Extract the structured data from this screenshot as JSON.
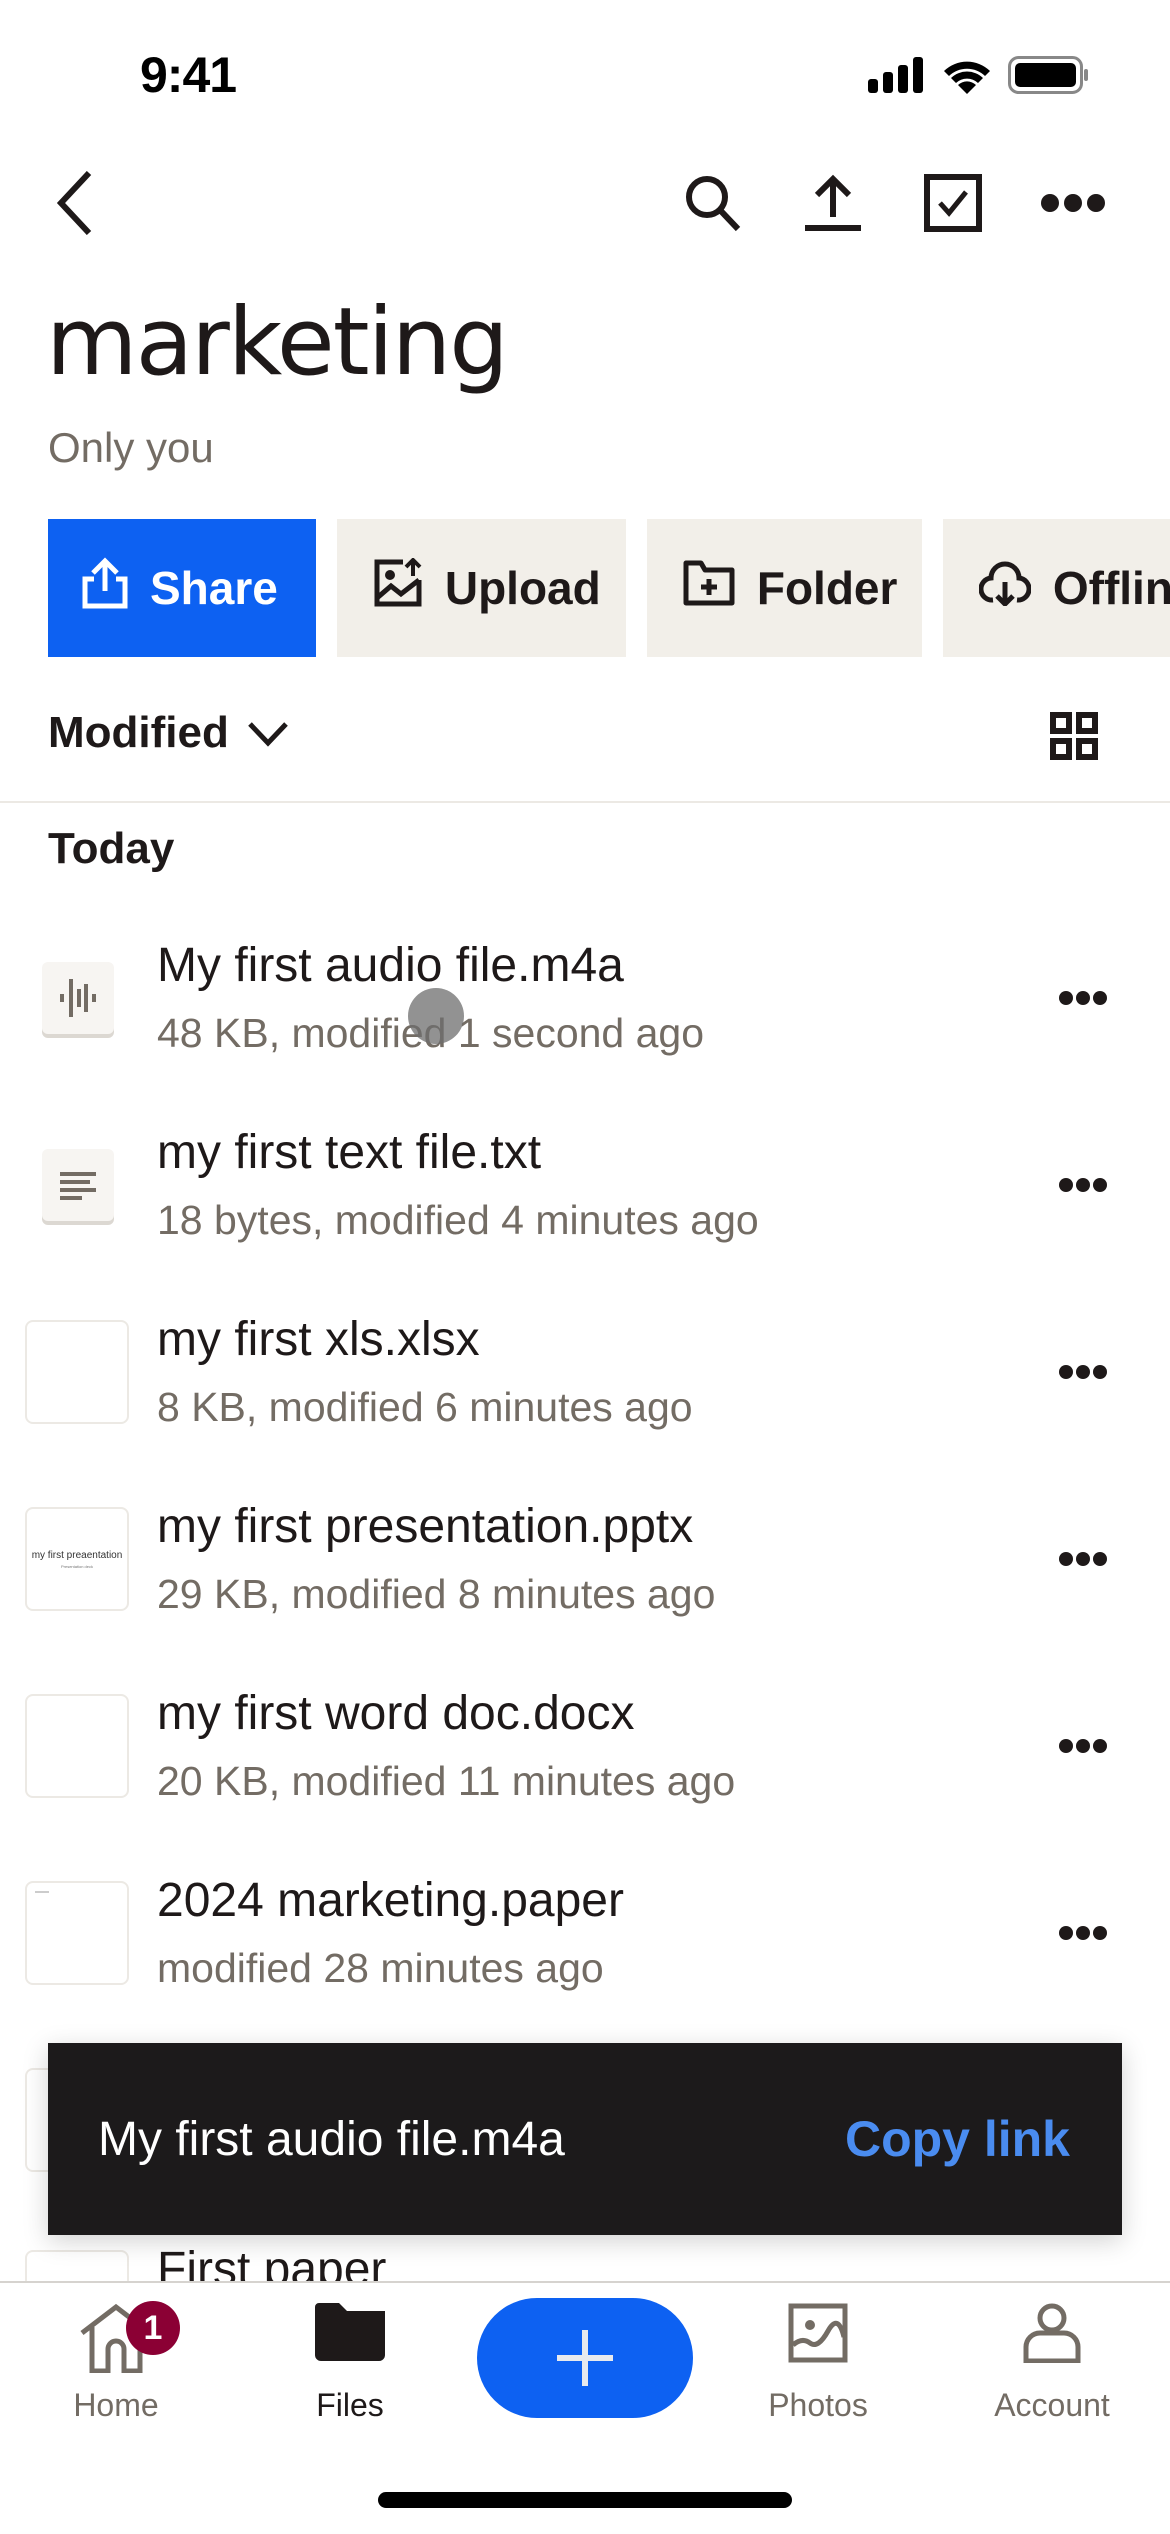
{
  "status_bar": {
    "time": "9:41",
    "icons": [
      "cellular-signal-icon",
      "wifi-icon",
      "battery-icon"
    ]
  },
  "nav": {
    "back_icon": "chevron-left-icon",
    "actions": [
      {
        "name": "search",
        "icon": "search-icon"
      },
      {
        "name": "upload",
        "icon": "upload-icon"
      },
      {
        "name": "select",
        "icon": "checkbox-icon"
      },
      {
        "name": "more",
        "icon": "more-horizontal-icon"
      }
    ]
  },
  "folder": {
    "title": "marketing",
    "sharing": "Only you"
  },
  "actions": [
    {
      "label": "Share",
      "icon": "share-icon",
      "primary": true
    },
    {
      "label": "Upload",
      "icon": "upload-photo-icon",
      "primary": false
    },
    {
      "label": "Folder",
      "icon": "new-folder-icon",
      "primary": false
    },
    {
      "label": "Offline",
      "icon": "cloud-download-icon",
      "primary": false
    }
  ],
  "sort": {
    "label": "Modified",
    "view_toggle_icon": "grid-view-icon"
  },
  "sections": [
    {
      "label": "Today",
      "files": [
        {
          "name": "My first audio file.m4a",
          "meta": "48 KB, modified 1 second ago",
          "thumb": "audio"
        },
        {
          "name": "my first text file.txt",
          "meta": "18 bytes, modified 4 minutes ago",
          "thumb": "text"
        },
        {
          "name": "my first xls.xlsx",
          "meta": "8 KB, modified 6 minutes ago",
          "thumb": "blank"
        },
        {
          "name": "my first presentation.pptx",
          "meta": "29 KB, modified 8 minutes ago",
          "thumb": "presentation",
          "thumb_text": "my first preaentation",
          "thumb_subtext": "Presentation deck"
        },
        {
          "name": "my first word doc.docx",
          "meta": "20 KB, modified 11 minutes ago",
          "thumb": "blank"
        },
        {
          "name": "2024 marketing.paper",
          "meta": "modified 28 minutes ago",
          "thumb": "paper"
        },
        {
          "name": "",
          "meta": "",
          "thumb": "blank"
        },
        {
          "name": "First paper",
          "meta": "",
          "thumb": "blank"
        }
      ]
    }
  ],
  "toast": {
    "message": "My first audio file.m4a",
    "action": "Copy link"
  },
  "tabbar": {
    "tabs": [
      {
        "label": "Home",
        "icon": "home-icon",
        "badge": "1",
        "active": false
      },
      {
        "label": "Files",
        "icon": "folder-icon",
        "active": true
      },
      {
        "label": "Photos",
        "icon": "photos-icon",
        "active": false
      },
      {
        "label": "Account",
        "icon": "account-icon",
        "active": false
      }
    ],
    "fab_icon": "plus-icon"
  },
  "colors": {
    "brand_blue": "#0d61f2",
    "secondary_button_bg": "#f2efe9",
    "badge": "#8b0034",
    "toast_bg": "#1c1a1b",
    "toast_action": "#4a8cf0",
    "muted_text": "#736c64"
  }
}
